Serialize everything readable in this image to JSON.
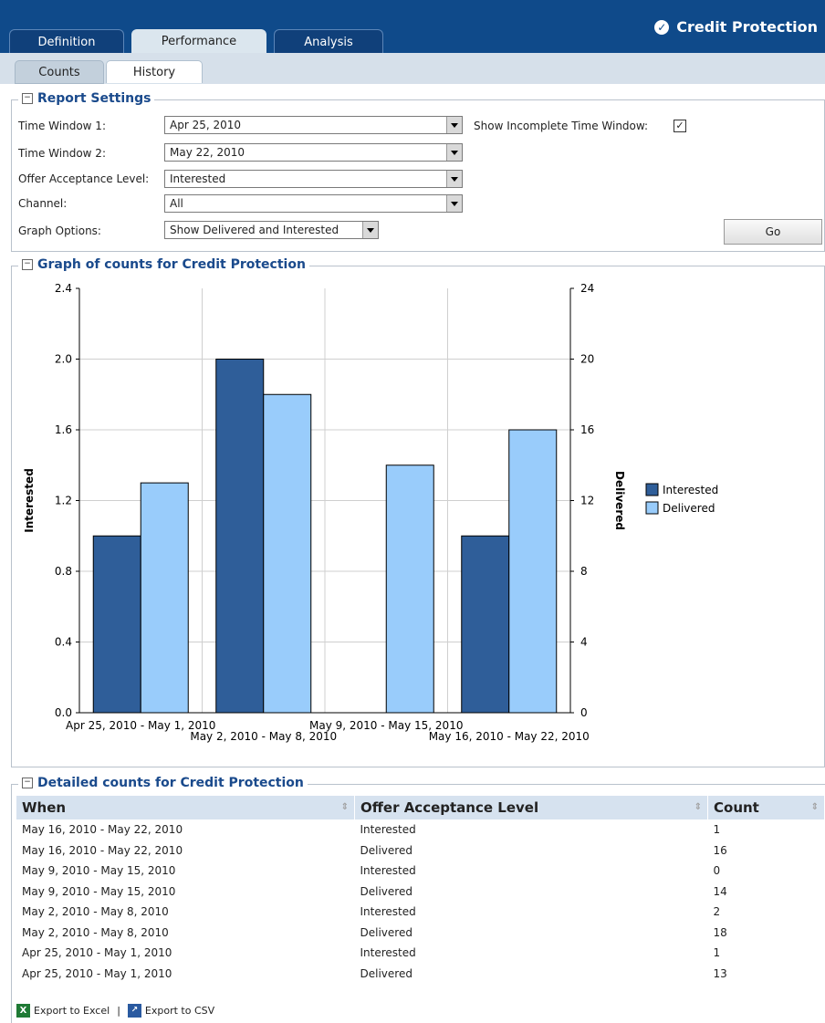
{
  "app": {
    "title": "Credit Protection"
  },
  "tabs": [
    {
      "label": "Definition"
    },
    {
      "label": "Performance"
    },
    {
      "label": "Analysis"
    }
  ],
  "subtabs": [
    {
      "label": "Counts"
    },
    {
      "label": "History"
    }
  ],
  "report_settings": {
    "title": "Report Settings",
    "fields": {
      "time_window_1": {
        "label": "Time Window 1:",
        "value": "Apr 25, 2010"
      },
      "time_window_2": {
        "label": "Time Window 2:",
        "value": "May 22, 2010"
      },
      "offer_acceptance_level": {
        "label": "Offer Acceptance Level:",
        "value": "Interested"
      },
      "channel": {
        "label": "Channel:",
        "value": "All"
      },
      "graph_options": {
        "label": "Graph Options:",
        "value": "Show Delivered and Interested"
      }
    },
    "show_incomplete": {
      "label": "Show Incomplete Time Window:",
      "checked": true,
      "mark": "✓"
    },
    "go_label": "Go"
  },
  "graph": {
    "title": "Graph of counts for Credit Protection"
  },
  "chart_data": {
    "type": "bar",
    "categories": [
      "Apr 25, 2010 - May 1, 2010",
      "May 2, 2010 - May 8, 2010",
      "May 9, 2010 - May 15, 2010",
      "May 16, 2010 - May 22, 2010"
    ],
    "series": [
      {
        "name": "Interested",
        "axis": "left",
        "color": "#2f5e99",
        "values": [
          1,
          2,
          0,
          1
        ]
      },
      {
        "name": "Delivered",
        "axis": "right",
        "color": "#99ccfb",
        "values": [
          13,
          18,
          14,
          16
        ]
      }
    ],
    "ylabel": "Interested",
    "ylabel_right": "Delivered",
    "ylim": [
      0,
      2.4
    ],
    "ylim_right": [
      0,
      24
    ],
    "left_ticks": [
      "0.0",
      "0.4",
      "0.8",
      "1.2",
      "1.6",
      "2.0",
      "2.4"
    ],
    "right_ticks": [
      "0",
      "4",
      "8",
      "12",
      "16",
      "20",
      "24"
    ],
    "legend_position": "right",
    "grid": true
  },
  "details": {
    "title": "Detailed counts for Credit Protection",
    "columns": [
      "When",
      "Offer Acceptance Level",
      "Count"
    ],
    "rows": [
      [
        "May 16, 2010 - May 22, 2010",
        "Interested",
        "1"
      ],
      [
        "May 16, 2010 - May 22, 2010",
        "Delivered",
        "16"
      ],
      [
        "May 9, 2010 - May 15, 2010",
        "Interested",
        "0"
      ],
      [
        "May 9, 2010 - May 15, 2010",
        "Delivered",
        "14"
      ],
      [
        "May 2, 2010 - May 8, 2010",
        "Interested",
        "2"
      ],
      [
        "May 2, 2010 - May 8, 2010",
        "Delivered",
        "18"
      ],
      [
        "Apr 25, 2010 - May 1, 2010",
        "Interested",
        "1"
      ],
      [
        "Apr 25, 2010 - May 1, 2010",
        "Delivered",
        "13"
      ]
    ]
  },
  "footer": {
    "export_excel": "Export to Excel",
    "separator": "|",
    "export_csv": "Export to CSV"
  },
  "icons": {
    "brand": "check-circle-icon",
    "collapse": "collapse-minus-icon",
    "excel": "excel-icon",
    "csv": "csv-icon",
    "sort": "sort-arrows-icon"
  }
}
